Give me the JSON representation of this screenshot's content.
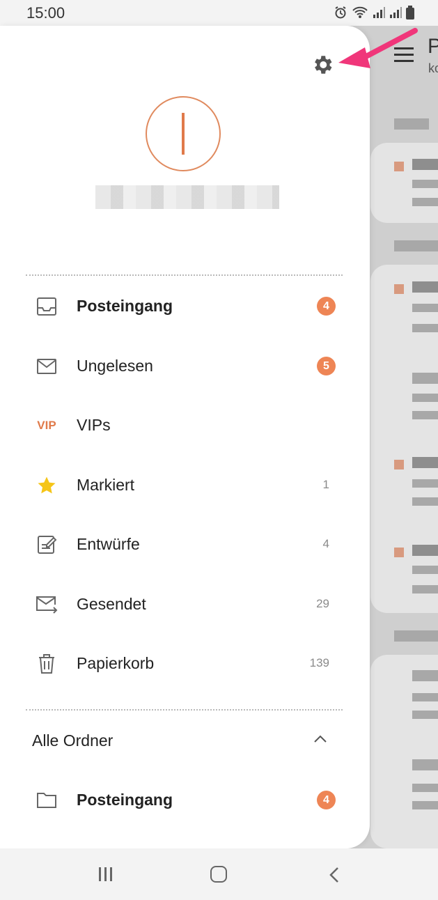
{
  "status": {
    "time": "15:00"
  },
  "background_app": {
    "title_partial": "P",
    "subtitle_partial": "ko"
  },
  "drawer": {
    "menu": [
      {
        "label": "Posteingang",
        "icon": "inbox-icon",
        "badge": "4",
        "bold": true
      },
      {
        "label": "Ungelesen",
        "icon": "envelope-icon",
        "badge": "5",
        "bold": false
      },
      {
        "label": "VIPs",
        "icon": "vip-icon",
        "icon_text": "VIP",
        "bold": false
      },
      {
        "label": "Markiert",
        "icon": "star-icon",
        "count": "1",
        "bold": false
      },
      {
        "label": "Entwürfe",
        "icon": "draft-icon",
        "count": "4",
        "bold": false
      },
      {
        "label": "Gesendet",
        "icon": "sent-icon",
        "count": "29",
        "bold": false
      },
      {
        "label": "Papierkorb",
        "icon": "trash-icon",
        "count": "139",
        "bold": false
      }
    ],
    "folders": {
      "title": "Alle Ordner",
      "items": [
        {
          "label": "Posteingang",
          "icon": "folder-icon",
          "badge": "4",
          "bold": true
        }
      ]
    }
  },
  "colors": {
    "accent": "#ee8555",
    "arrow": "#f0367a",
    "star": "#f5c518"
  }
}
